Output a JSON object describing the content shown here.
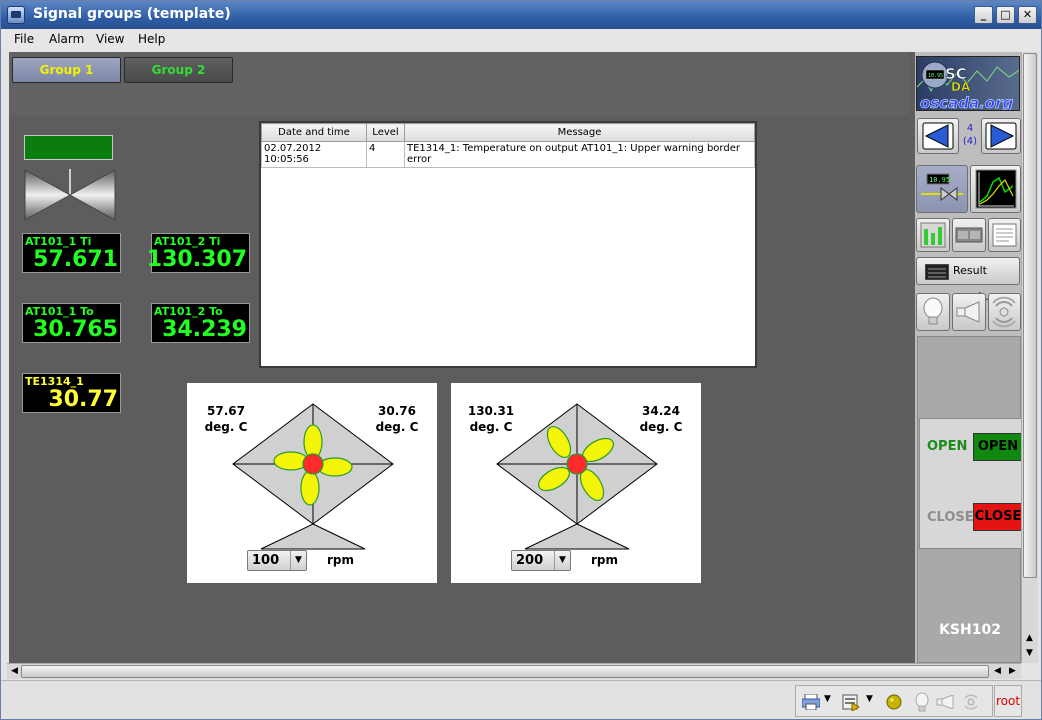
{
  "window": {
    "title": "Signal groups (template)"
  },
  "menubar": {
    "file": "File",
    "alarm": "Alarm",
    "view": "View",
    "help": "Help"
  },
  "groups": [
    {
      "label": "Group 1"
    },
    {
      "label": "Group 2"
    }
  ],
  "displays": [
    {
      "label": "AT101_1 Ti",
      "value": "57.671"
    },
    {
      "label": "AT101_2 Ti",
      "value": "130.307"
    },
    {
      "label": "AT101_1 To",
      "value": "30.765"
    },
    {
      "label": "AT101_2 To",
      "value": "34.239"
    },
    {
      "label": "TE1314_1",
      "value": "30.77"
    }
  ],
  "alarm_table": {
    "columns": [
      "Date and time",
      "Level",
      "Message"
    ],
    "rows": [
      {
        "datetime": "02.07.2012 10:05:56",
        "level": "4",
        "message": "TE1314_1: Temperature on output  AT101_1: Upper warning border error"
      }
    ]
  },
  "fans": [
    {
      "left_value": "57.67",
      "right_value": "30.76",
      "unit": "deg. C",
      "rpm": "100",
      "rpm_label": "rpm"
    },
    {
      "left_value": "130.31",
      "right_value": "34.24",
      "unit": "deg. C",
      "rpm": "200",
      "rpm_label": "rpm"
    }
  ],
  "side": {
    "logo_line1": "SC",
    "logo_line2": "DA",
    "logo_site": "oscada.org",
    "logo_value": "10.95",
    "page_num": "4",
    "page_total": "(4)",
    "result_graph": "Result graph.",
    "open_status": "OPEN",
    "open_button": "OPEN",
    "close_status": "CLOSE",
    "close_button": "CLOSE",
    "device": "KSH102"
  },
  "statusbar": {
    "user": "root"
  },
  "colors": {
    "valve_ok": "#0b7d10",
    "display_green": "#22ff22",
    "display_yellow": "#ffff33",
    "open_green": "#1a8c1a",
    "close_red": "#e51414"
  }
}
